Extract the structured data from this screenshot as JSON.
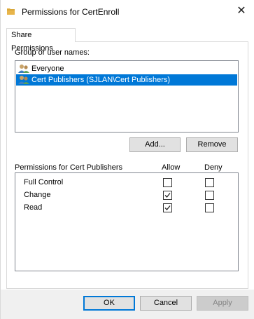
{
  "window": {
    "title": "Permissions for CertEnroll",
    "close_glyph": "✕"
  },
  "tabs": [
    {
      "label": "Share Permissions",
      "active": true
    }
  ],
  "group_section": {
    "label": "Group or user names:",
    "items": [
      {
        "label": "Everyone",
        "icon": "users-icon",
        "selected": false
      },
      {
        "label": "Cert Publishers (SJLAN\\Cert Publishers)",
        "icon": "users-icon",
        "selected": true
      }
    ],
    "add_label": "Add...",
    "remove_label": "Remove"
  },
  "permissions": {
    "header": "Permissions for Cert Publishers",
    "allow_label": "Allow",
    "deny_label": "Deny",
    "rows": [
      {
        "name": "Full Control",
        "allow": false,
        "deny": false
      },
      {
        "name": "Change",
        "allow": true,
        "deny": false
      },
      {
        "name": "Read",
        "allow": true,
        "deny": false
      }
    ]
  },
  "buttons": {
    "ok": "OK",
    "cancel": "Cancel",
    "apply": "Apply"
  },
  "colors": {
    "selection": "#0078d7",
    "folder": "#e8b54a",
    "border": "#828790"
  }
}
